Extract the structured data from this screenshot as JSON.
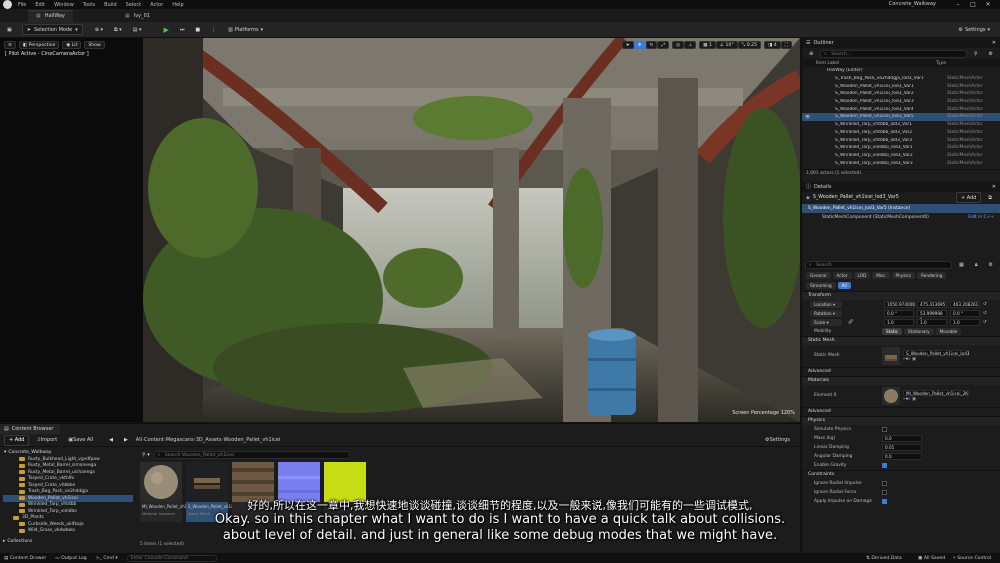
{
  "menubar": {
    "items": [
      "File",
      "Edit",
      "Window",
      "Tools",
      "Build",
      "Select",
      "Actor",
      "Help"
    ],
    "project_title": "Concrete_Walkway"
  },
  "tabs": [
    {
      "label": "HallWay"
    },
    {
      "label": "Ivy_01"
    }
  ],
  "toolbar": {
    "mode_label": "Selection Mode",
    "platforms_label": "Platforms",
    "settings_label": "Settings"
  },
  "viewport": {
    "perspective_label": "Perspective",
    "lit_label": "Lit",
    "show_label": "Show",
    "pilot_label": "[ Pilot Active - CineCameraActor ]",
    "snap_angle": "10°",
    "scale_snap": "0.25",
    "camera_speed": "4",
    "grid_size": "1",
    "screen_percentage": "Screen Percentage  120%"
  },
  "outliner": {
    "title": "Outliner",
    "search_placeholder": "Search...",
    "col_item_label": "Item Label",
    "col_type": "Type",
    "rows": [
      {
        "name": "HallWay (Editor)",
        "type": ""
      },
      {
        "name": "S_Trash_Bag_Pack_ve2hddgja_lod3_Var1",
        "type": "StaticMeshActor"
      },
      {
        "name": "S_Wooden_Pallet_vh1icei_lod3_Var1",
        "type": "StaticMeshActor"
      },
      {
        "name": "S_Wooden_Pallet_vh1icei_lod3_Var2",
        "type": "StaticMeshActor"
      },
      {
        "name": "S_Wooden_Pallet_vh1icei_lod3_Var3",
        "type": "StaticMeshActor"
      },
      {
        "name": "S_Wooden_Pallet_vh1icei_lod3_Var4",
        "type": "StaticMeshActor"
      },
      {
        "name": "S_Wooden_Pallet_vh1icei_lod3_Var5",
        "type": "StaticMeshActor",
        "selected": true
      },
      {
        "name": "S_Wrinkled_Tarp_vhtdbb_lod3_Var1",
        "type": "StaticMeshActor"
      },
      {
        "name": "S_Wrinkled_Tarp_vhtdbb_lod3_Var2",
        "type": "StaticMeshActor"
      },
      {
        "name": "S_Wrinkled_Tarp_vhtdbb_lod3_Var3",
        "type": "StaticMeshActor"
      },
      {
        "name": "S_Wrinkled_Tarp_vieldbo_lod3_Var1",
        "type": "StaticMeshActor"
      },
      {
        "name": "S_Wrinkled_Tarp_vieldbo_lod3_Var2",
        "type": "StaticMeshActor"
      },
      {
        "name": "S_Wrinkled_Tarp_vieldbo_lod3_Var3",
        "type": "StaticMeshActor"
      }
    ],
    "actor_count": "1,001 actors (1 selected)"
  },
  "details": {
    "title": "Details",
    "actor_name": "S_Wooden_Pallet_vh1icei_lod3_Var5",
    "add_label": "+ Add",
    "instance_row": "S_Wooden_Pallet_vh1icei_lod3_Var5 (Instance)",
    "component_row": "StaticMeshComponent (StaticMeshComponent0)",
    "edit_in_cpp": "Edit in C++",
    "search_placeholder": "Search",
    "filter_tabs_row1": [
      "General",
      "Actor",
      "LOD",
      "Misc",
      "Physics",
      "Rendering"
    ],
    "filter_tabs_row2": [
      "Streaming",
      "All"
    ],
    "transform_section": "Transform",
    "location_label": "Location",
    "location_values": [
      "1050.974000",
      "475.413695",
      "403.208261"
    ],
    "rotation_label": "Rotation",
    "rotation_values": [
      "0.0 °",
      "53.999998 °",
      "0.0 °"
    ],
    "scale_label": "Scale",
    "scale_values": [
      "1.0",
      "1.0",
      "1.0"
    ],
    "mobility_label": "Mobility",
    "mobility_options": [
      "Static",
      "Stationary",
      "Movable"
    ],
    "static_mesh_section": "Static Mesh",
    "static_mesh_label": "Static Mesh",
    "static_mesh_value": "S_Wooden_Pallet_vh1icei_lod3",
    "advanced_label": "Advanced",
    "materials_section": "Materials",
    "element0_label": "Element 0",
    "element0_value": "MI_Wooden_Pallet_vh1icei_2K",
    "advanced_label2": "Advanced",
    "physics_section": "Physics",
    "physics_props": [
      {
        "label": "Simulate Physics",
        "value": ""
      },
      {
        "label": "Mass (kg)",
        "value": "0.0"
      },
      {
        "label": "Linear Damping",
        "value": "0.01"
      },
      {
        "label": "Angular Damping",
        "value": "0.0"
      },
      {
        "label": "Enable Gravity",
        "value": ""
      }
    ],
    "constraints_section": "Constraints",
    "extra_props": [
      "Ignore Radial Impulse",
      "Ignore Radial Force",
      "Apply Impulse on Damage"
    ]
  },
  "content_browser": {
    "title": "Content Browser",
    "add_label": "+ Add",
    "import_label": "Import",
    "save_all_label": "Save All",
    "path": [
      "All",
      "Content",
      "Megascans",
      "3D_Assets",
      "Wooden_Pallet_vh1icei"
    ],
    "settings_label": "Settings",
    "search_placeholder": "Search Wooden_Pallet_vh1icei",
    "tree_root": "Concrete_Walkway",
    "tree": [
      "Rusty_Bulkhead_Light_vgvdfpaw",
      "Rusty_Metal_Barrel_simaneega",
      "Rusty_Metal_Barrel_uichaenga",
      "Tarped_Crate_vkthlfo",
      "Tarped_Crate_vhbbke",
      "Trash_Bag_Pack_ve2hddgja",
      "Wooden_Pallet_vh1icei",
      "Wrinkled_Tarp_vhtdbb",
      "Wrinkled_Tarp_vieldbo",
      "3D_Plants",
      "Curbside_Weeds_ukifkaja",
      "Wild_Grass_vkdwbwa"
    ],
    "collections_label": "Collections",
    "assets": [
      {
        "caption": "MI_Wooden_Pallet_vh1icei_2K",
        "kind": "Material Instance"
      },
      {
        "caption": "S_Wooden_Pallet_vh1icei_lod3_Var",
        "kind": "Static Mesh"
      },
      {
        "caption": "",
        "kind": ""
      },
      {
        "caption": "",
        "kind": ""
      },
      {
        "caption": "",
        "kind": ""
      }
    ],
    "item_count": "5 items (1 selected)"
  },
  "statusbar": {
    "content_drawer": "Content Drawer",
    "output_log": "Output Log",
    "cmd_label": "Cmd",
    "cmd_placeholder": "Enter Console Command",
    "derived_data": "Derived Data",
    "all_saved": "All Saved",
    "source_control": "Source Control"
  },
  "subtitles": {
    "line_zh": "好的,所以在这一章中,我想快速地谈谈碰撞,谈谈细节的程度,以及一般来说,像我们可能有的一些调试模式,",
    "line_en1": "Okay. so in this chapter what I want to do is I want to have a quick talk about collisions.",
    "line_en2": "about level of detail. and just in general like some debug modes that we might have."
  },
  "colors": {
    "accent": "#3a7bd5",
    "selection": "#2f4f74",
    "folder": "#c79b3a",
    "play_green": "#4fbf4f"
  }
}
